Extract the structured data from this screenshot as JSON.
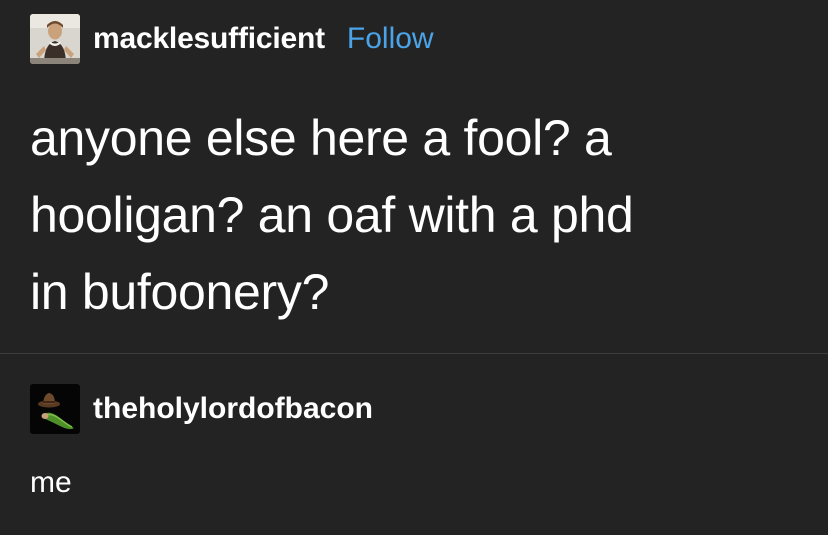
{
  "post": {
    "author": "macklesufficient",
    "follow_label": "Follow",
    "text": "anyone else here a fool? a\nhooligan? an oaf with a phd\nin bufoonery?",
    "avatar_icon": "shakespeare-portrait-avatar-icon"
  },
  "reply": {
    "author": "theholylordofbacon",
    "text": "me",
    "avatar_icon": "pickle-with-hat-avatar-icon"
  },
  "colors": {
    "background": "#232323",
    "text": "#ffffff",
    "follow_link": "#4ba3e8",
    "divider": "#3d3d3d"
  }
}
